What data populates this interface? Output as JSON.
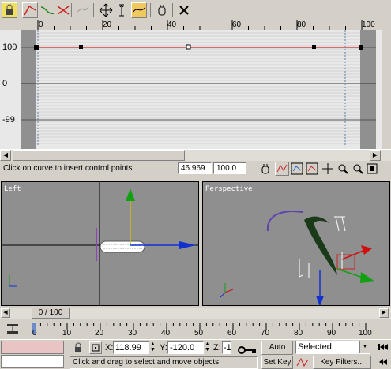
{
  "toolbar": {
    "icons": [
      "lock-icon",
      "curve-toolbar-icon",
      "tangent-icon",
      "delete-key-icon",
      "flat-icon",
      "move-keys-icon",
      "scale-keys-icon",
      "add-keys-icon",
      "hand-icon",
      "close-icon"
    ]
  },
  "curve_editor": {
    "ruler_ticks": [
      "0",
      "20",
      "40",
      "60",
      "80",
      "100"
    ],
    "y_labels": [
      "100",
      "0",
      "-99"
    ],
    "status_text": "Click on curve to insert control points.",
    "frame_value": "46.969",
    "value_field": "100.0"
  },
  "viewports": {
    "left_label": "Left",
    "perspective_label": "Perspective"
  },
  "time_slider": {
    "label": "0 / 100",
    "current": 0,
    "total": 100
  },
  "track_bar": {
    "ticks": [
      "0",
      "10",
      "20",
      "30",
      "40",
      "50",
      "60",
      "70",
      "80",
      "90",
      "100"
    ]
  },
  "status_bar": {
    "x_value": "118.99",
    "y_value": "-120.0",
    "z_value": "-1",
    "x_label": "X:",
    "y_label": "Y:",
    "z_label": "Z:",
    "prompt": "Click and drag to select and move objects",
    "auto_key": "Auto Key",
    "set_key": "Set Key",
    "selected": "Selected",
    "key_filters": "Key Filters..."
  },
  "colors": {
    "curve": "#cc2222",
    "viewport_bg": "#8f8f8f",
    "axis_x": "#d01010",
    "axis_y": "#10a010",
    "axis_z": "#1030d0"
  }
}
